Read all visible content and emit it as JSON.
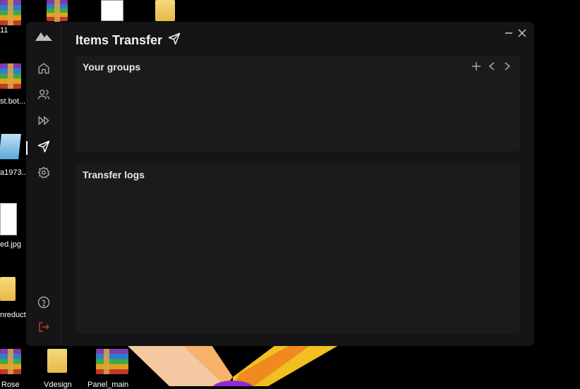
{
  "desktop": {
    "labels": [
      "11",
      "st.bot...",
      "a1973...",
      "ed.jpg",
      "nreduct",
      "Rose",
      "Vdesign",
      "Panel_main"
    ]
  },
  "app": {
    "title": "Items Transfer",
    "sidebar": {
      "items": [
        {
          "name": "home",
          "icon": "home-icon"
        },
        {
          "name": "users",
          "icon": "users-icon"
        },
        {
          "name": "forward",
          "icon": "fast-forward-icon"
        },
        {
          "name": "transfer",
          "icon": "send-icon",
          "active": true
        },
        {
          "name": "settings",
          "icon": "gear-icon"
        },
        {
          "name": "help",
          "icon": "help-icon"
        },
        {
          "name": "logout",
          "icon": "logout-icon"
        }
      ]
    },
    "groups_panel": {
      "title": "Your groups"
    },
    "logs_panel": {
      "title": "Transfer logs"
    },
    "colors": {
      "background": "#151517",
      "panel": "#1b1b1d",
      "logout": "#c0392b",
      "text": "#f0f0f0"
    }
  }
}
